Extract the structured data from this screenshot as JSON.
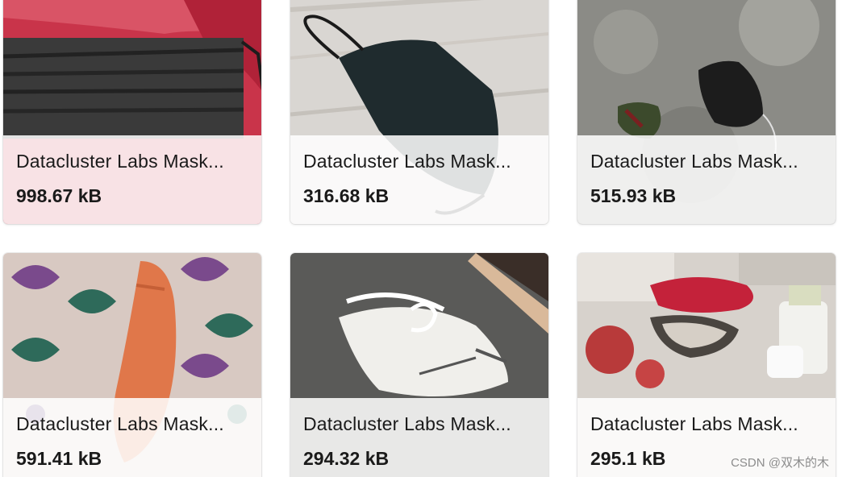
{
  "cards": [
    {
      "title": "Datacluster Labs Mask...",
      "size": "998.67 kB"
    },
    {
      "title": "Datacluster Labs Mask...",
      "size": "316.68 kB"
    },
    {
      "title": "Datacluster Labs Mask...",
      "size": "515.93 kB"
    },
    {
      "title": "Datacluster Labs Mask...",
      "size": "591.41 kB"
    },
    {
      "title": "Datacluster Labs Mask...",
      "size": "294.32 kB"
    },
    {
      "title": "Datacluster Labs Mask...",
      "size": "295.1 kB"
    }
  ],
  "watermark": "CSDN @双木的木"
}
